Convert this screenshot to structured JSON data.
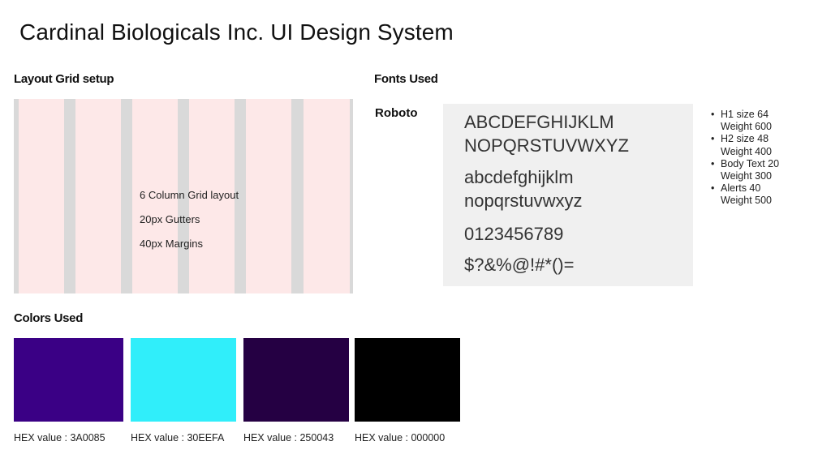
{
  "page": {
    "title": "Cardinal Biologicals Inc.  UI Design System"
  },
  "layout_grid": {
    "heading": "Layout Grid setup",
    "columns": 6,
    "description_lines": [
      "6 Column Grid layout",
      "20px Gutters",
      "40px Margins"
    ],
    "column_color": "#fde8e8",
    "gutter_color": "#d9d9d9"
  },
  "fonts": {
    "heading": "Fonts Used",
    "font_name": "Roboto",
    "specimen": [
      "ABCDEFGHIJKLM",
      "NOPQRSTUVWXYZ",
      "abcdefghijklm",
      "nopqrstuvwxyz",
      "0123456789",
      "$?&%@!#*()="
    ],
    "styles": [
      {
        "label": "H1 size 64",
        "weight": "Weight 600"
      },
      {
        "label": "H2 size 48",
        "weight": "Weight 400"
      },
      {
        "label": "Body Text 20",
        "weight": "Weight 300"
      },
      {
        "label": "Alerts 40",
        "weight": "Weight 500"
      }
    ]
  },
  "colors": {
    "heading": "Colors Used",
    "swatches": [
      {
        "hex": "#3A0085",
        "label": "HEX value : 3A0085"
      },
      {
        "hex": "#30EEFA",
        "label": "HEX value : 30EEFA"
      },
      {
        "hex": "#250043",
        "label": "HEX value : 250043"
      },
      {
        "hex": "#000000",
        "label": "HEX value : 000000"
      }
    ]
  }
}
